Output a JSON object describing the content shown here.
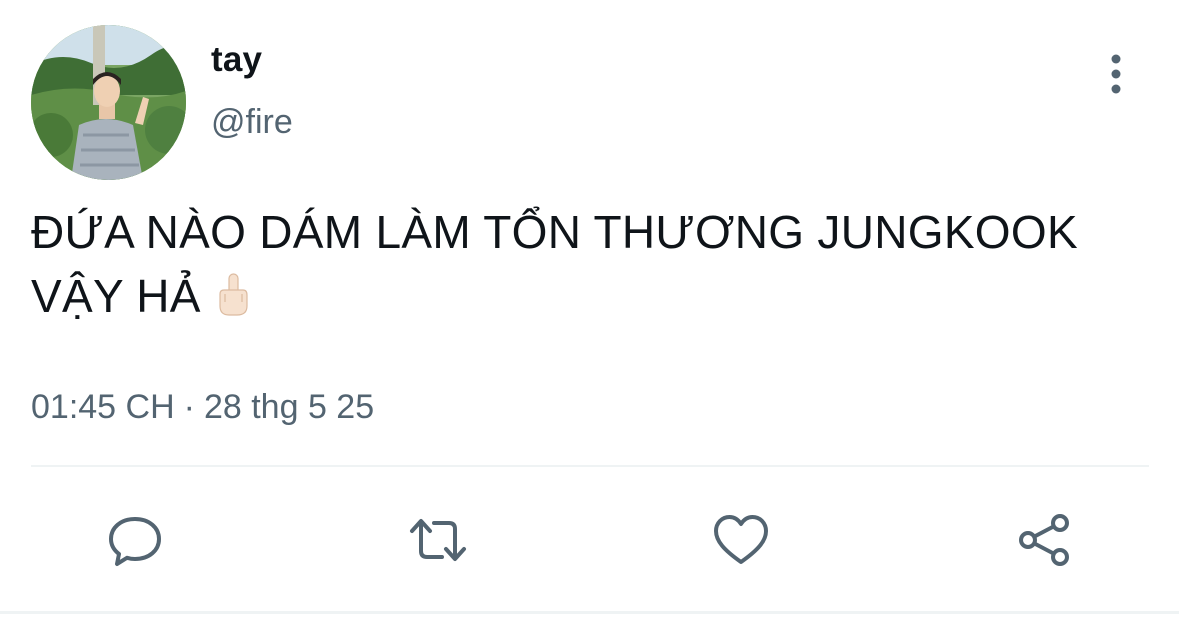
{
  "author": {
    "display_name": "tay",
    "handle": "@fire",
    "avatar": "profile-photo"
  },
  "tweet": {
    "text_line1": "ĐỨA NÀO DÁM LÀM TỔN THƯƠNG JUNGKOOK",
    "text_line2": "VẬY HẢ",
    "emoji": "middle-finger-emoji-light-skin"
  },
  "meta": {
    "time": "01:45 CH",
    "separator": "·",
    "date": "28 thg 5 25"
  },
  "actions": [
    {
      "icon": "reply-icon"
    },
    {
      "icon": "retweet-icon"
    },
    {
      "icon": "like-icon"
    },
    {
      "icon": "share-icon"
    }
  ],
  "colors": {
    "text": "#0f1419",
    "secondary": "#536471",
    "divider": "#eff3f4"
  }
}
